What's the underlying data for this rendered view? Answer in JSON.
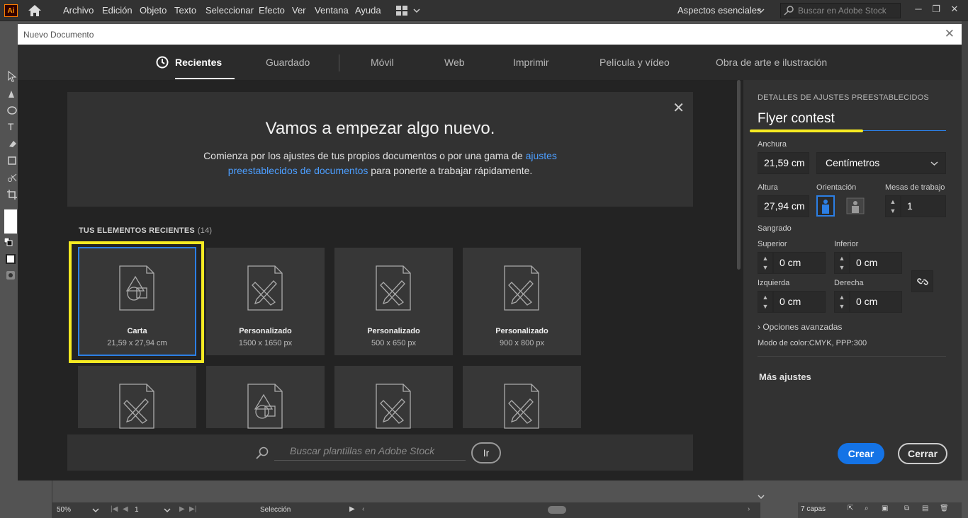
{
  "app": {
    "logo_text": "Ai",
    "menu": [
      "Archivo",
      "Edición",
      "Objeto",
      "Texto",
      "Seleccionar",
      "Efecto",
      "Ver",
      "Ventana",
      "Ayuda"
    ],
    "workspace": "Aspectos esenciales",
    "stock_search_placeholder": "Buscar en Adobe Stock"
  },
  "dialog": {
    "title": "Nuevo Documento",
    "tabs": [
      "Recientes",
      "Guardado",
      "Móvil",
      "Web",
      "Imprimir",
      "Película y vídeo",
      "Obra de arte e ilustración"
    ],
    "welcome": {
      "title": "Vamos a empezar algo nuevo.",
      "text_before": "Comienza por los ajustes de tus propios documentos o por una gama de ",
      "link": "ajustes preestablecidos de documentos",
      "text_after": " para ponerte a trabajar rápidamente."
    },
    "recent": {
      "title": "TUS ELEMENTOS RECIENTES",
      "count": "(14)",
      "items": [
        {
          "name": "Carta",
          "size": "21,59 x 27,94 cm"
        },
        {
          "name": "Personalizado",
          "size": "1500 x 1650 px"
        },
        {
          "name": "Personalizado",
          "size": "500 x 650 px"
        },
        {
          "name": "Personalizado",
          "size": "900 x 800 px"
        }
      ]
    },
    "template_search_placeholder": "Buscar plantillas en Adobe Stock",
    "go_label": "Ir",
    "details": {
      "heading": "DETALLES DE AJUSTES PREESTABLECIDOS",
      "preset_name": "Flyer contest",
      "width_label": "Anchura",
      "width_value": "21,59 cm",
      "units": "Centímetros",
      "height_label": "Altura",
      "height_value": "27,94 cm",
      "orientation_label": "Orientación",
      "artboards_label": "Mesas de trabajo",
      "artboards_value": "1",
      "bleed_label": "Sangrado",
      "top_label": "Superior",
      "top_value": "0 cm",
      "bottom_label": "Inferior",
      "bottom_value": "0 cm",
      "left_label": "Izquierda",
      "left_value": "0 cm",
      "right_label": "Derecha",
      "right_value": "0 cm",
      "advanced": "Opciones avanzadas",
      "color_mode": "Modo de color:CMYK, PPP:300",
      "more_settings": "Más ajustes",
      "create": "Crear",
      "close": "Cerrar"
    }
  },
  "status": {
    "zoom": "50%",
    "page": "1",
    "tool": "Selección",
    "layers": "7 capas"
  }
}
